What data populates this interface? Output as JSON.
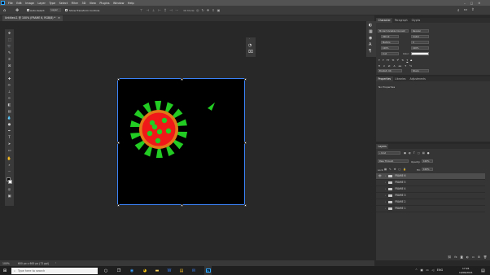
{
  "app": {
    "logo_text": "Ps"
  },
  "menu": [
    "File",
    "Edit",
    "Image",
    "Layer",
    "Type",
    "Select",
    "Filter",
    "3D",
    "View",
    "Plugins",
    "Window",
    "Help"
  ],
  "options_bar": {
    "auto_select_label": "Auto-Select:",
    "auto_select_target": "Layer",
    "transform_controls_label": "Show Transform Controls",
    "mode_3d_label": "3D Mode:"
  },
  "document_tab": {
    "title": "Untitled-1 @ 100% (FRAME 6, RGB/8) *"
  },
  "status_bar": {
    "zoom": "100%",
    "doc_info": "600 px x 600 px (72 ppi)"
  },
  "character_panel": {
    "tabs": [
      "Character",
      "Paragraph",
      "Glyphs"
    ],
    "font_family": "Myriad Variable Concept",
    "font_style": "Regular",
    "font_size": "200 pt",
    "leading": "(Auto)",
    "kerning": "Metrics",
    "tracking": "0",
    "vertical_scale": "100%",
    "horizontal_scale": "100%",
    "baseline_shift": "0 pt",
    "color_label": "Color:",
    "color": "#ffffff",
    "language": "English: UK",
    "antialias": "Sharp"
  },
  "properties_panel": {
    "tabs": [
      "Properties",
      "Libraries",
      "Adjustments"
    ],
    "empty_text": "No Properties"
  },
  "layers_panel": {
    "tabs": [
      "Layers"
    ],
    "filter_kind": "Kind",
    "blend_mode": "Pass Through",
    "opacity_label": "Opacity:",
    "opacity": "100%",
    "lock_label": "Lock:",
    "fill_label": "Fill:",
    "fill": "100%",
    "layers": [
      {
        "name": "FRAME 6",
        "selected": true,
        "visible": true
      },
      {
        "name": "FRAME 5",
        "selected": false,
        "visible": false
      },
      {
        "name": "FRAME 4",
        "selected": false,
        "visible": false
      },
      {
        "name": "FRAME 3",
        "selected": false,
        "visible": false
      },
      {
        "name": "FRAME 2",
        "selected": false,
        "visible": false
      },
      {
        "name": "FRAME 1",
        "selected": false,
        "visible": false
      }
    ]
  },
  "taskbar": {
    "search_placeholder": "Type here to search",
    "clock_time": "17:26",
    "clock_date": "10/06/2021",
    "language": "ENG"
  },
  "colors": {
    "virus_body": "#f01818",
    "virus_ring": "#e07818",
    "virus_spikes": "#22cc22",
    "selection": "#3b82f6",
    "color_swatch": "#ffffff"
  }
}
